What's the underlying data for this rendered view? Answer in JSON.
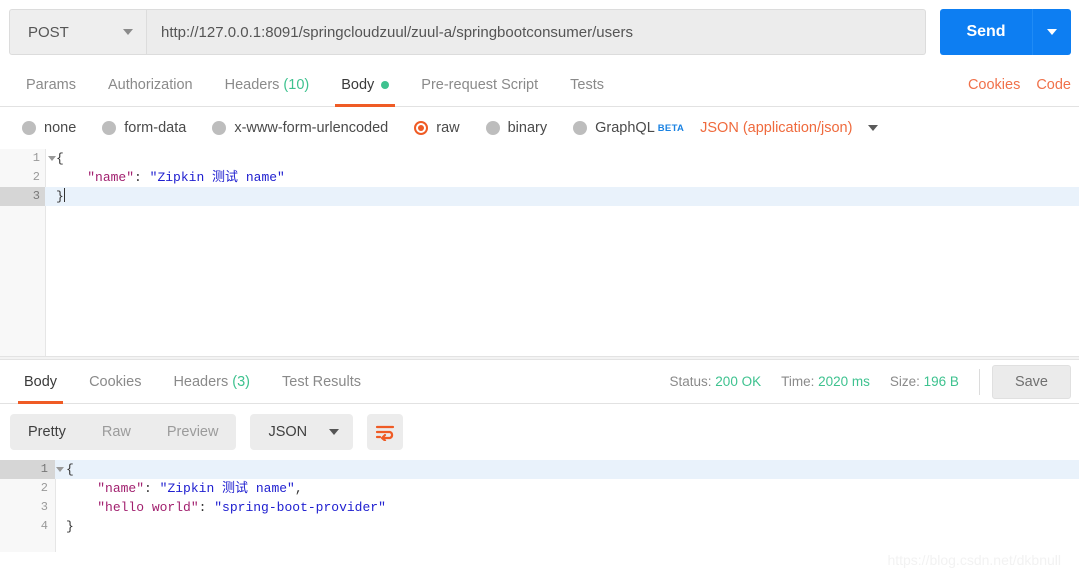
{
  "request": {
    "method": "POST",
    "url": "http://127.0.0.1:8091/springcloudzuul/zuul-a/springbootconsumer/users",
    "send_label": "Send",
    "tabs": [
      {
        "label": "Params",
        "active": false
      },
      {
        "label": "Authorization",
        "active": false
      },
      {
        "label": "Headers",
        "count": "(10)",
        "active": false
      },
      {
        "label": "Body",
        "active": true,
        "dot": true
      },
      {
        "label": "Pre-request Script",
        "active": false
      },
      {
        "label": "Tests",
        "active": false
      }
    ],
    "tabs_right": [
      "Cookies",
      "Code"
    ],
    "body_types": [
      {
        "label": "none",
        "checked": false
      },
      {
        "label": "form-data",
        "checked": false
      },
      {
        "label": "x-www-form-urlencoded",
        "checked": false
      },
      {
        "label": "raw",
        "checked": true
      },
      {
        "label": "binary",
        "checked": false
      },
      {
        "label": "GraphQL",
        "checked": false,
        "badge": "BETA"
      }
    ],
    "content_type": "JSON (application/json)",
    "editor_lines": [
      {
        "num": "1",
        "fold": true,
        "highlight": false,
        "punc_open": "{"
      },
      {
        "num": "2",
        "fold": false,
        "highlight": false,
        "key": "\"name\"",
        "colon": ": ",
        "value": "\"Zipkin 测试 name\""
      },
      {
        "num": "3",
        "fold": false,
        "highlight": true,
        "punc_close": "}"
      }
    ]
  },
  "response": {
    "tabs": [
      {
        "label": "Body",
        "active": true
      },
      {
        "label": "Cookies",
        "active": false
      },
      {
        "label": "Headers",
        "count": "(3)",
        "active": false
      },
      {
        "label": "Test Results",
        "active": false
      }
    ],
    "status_label": "Status:",
    "status_value": "200 OK",
    "time_label": "Time:",
    "time_value": "2020 ms",
    "size_label": "Size:",
    "size_value": "196 B",
    "save_label": "Save",
    "view_modes": [
      {
        "label": "Pretty",
        "active": true
      },
      {
        "label": "Raw",
        "active": false
      },
      {
        "label": "Preview",
        "active": false
      }
    ],
    "format": "JSON",
    "body_lines": [
      {
        "num": "1",
        "fold": true,
        "highlight": true,
        "punc_open": "{"
      },
      {
        "num": "2",
        "fold": false,
        "highlight": false,
        "key": "\"name\"",
        "colon": ": ",
        "value": "\"Zipkin 测试 name\"",
        "trail": ","
      },
      {
        "num": "3",
        "fold": false,
        "highlight": false,
        "key": "\"hello world\"",
        "colon": ": ",
        "value": "\"spring-boot-provider\""
      },
      {
        "num": "4",
        "fold": false,
        "highlight": false,
        "punc_close": "}"
      }
    ]
  },
  "watermark": "https://blog.csdn.net/dkbnull",
  "colors": {
    "accent_orange": "#ef5b25",
    "send_blue": "#0d7ef2",
    "status_green": "#3ec28f",
    "beta_blue": "#1a82e2",
    "string_blue": "#2020d0",
    "key_magenta": "#a11f6e"
  }
}
